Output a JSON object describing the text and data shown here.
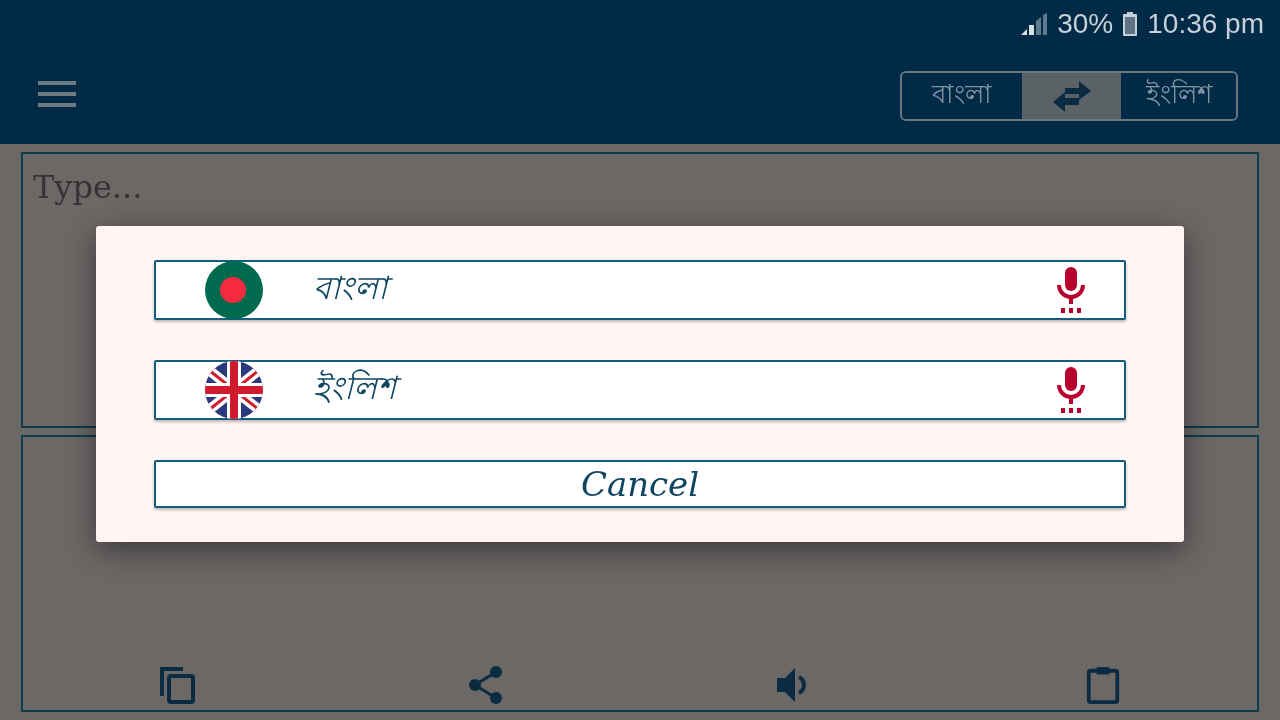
{
  "status_bar": {
    "battery": "30%",
    "time": "10:36 pm"
  },
  "app_bar": {
    "language_toggle": {
      "source": "বাংলা",
      "target": "ইংলিশ"
    }
  },
  "input_panel": {
    "placeholder": "Type..."
  },
  "dialog": {
    "options": [
      {
        "kind": "bangla",
        "label": "বাংলা"
      },
      {
        "kind": "english",
        "label": "ইংলিশ"
      }
    ],
    "cancel": "Cancel"
  }
}
